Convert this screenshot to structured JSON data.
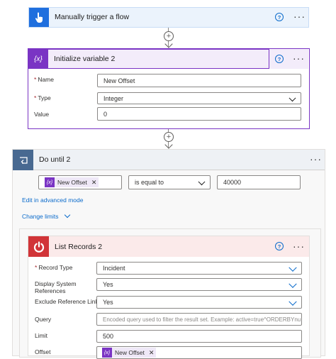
{
  "trigger": {
    "title": "Manually trigger a flow"
  },
  "init_var": {
    "title": "Initialize variable 2",
    "icon_glyph": "{x}",
    "name_label": "Name",
    "name_value": "New Offset",
    "type_label": "Type",
    "type_value": "Integer",
    "value_label": "Value",
    "value_value": "0"
  },
  "do_until": {
    "title": "Do until 2",
    "condition_token": "New Offset",
    "operator": "is equal to",
    "compare_value": "40000",
    "edit_link": "Edit in advanced mode",
    "change_limits": "Change limits"
  },
  "list_records": {
    "title": "List Records 2",
    "record_type_label": "Record Type",
    "record_type_value": "Incident",
    "display_refs_label": "Display System References",
    "display_refs_value": "Yes",
    "exclude_refs_label": "Exclude Reference Links",
    "exclude_refs_value": "Yes",
    "query_label": "Query",
    "query_placeholder": "Encoded query used to filter the result set. Example: active=true^ORDERBYnu",
    "limit_label": "Limit",
    "limit_value": "500",
    "offset_label": "Offset",
    "offset_token": "New Offset"
  },
  "colors": {
    "trigger_accent": "#1f6fde",
    "variable_accent": "#7a34c4",
    "loop_accent": "#486991",
    "servicenow_accent": "#d13438",
    "link": "#0b6bcb"
  },
  "icons": {
    "trigger": "hand-pointer-icon",
    "variable": "variable-icon",
    "loop": "loop-icon",
    "servicenow": "power-icon"
  }
}
